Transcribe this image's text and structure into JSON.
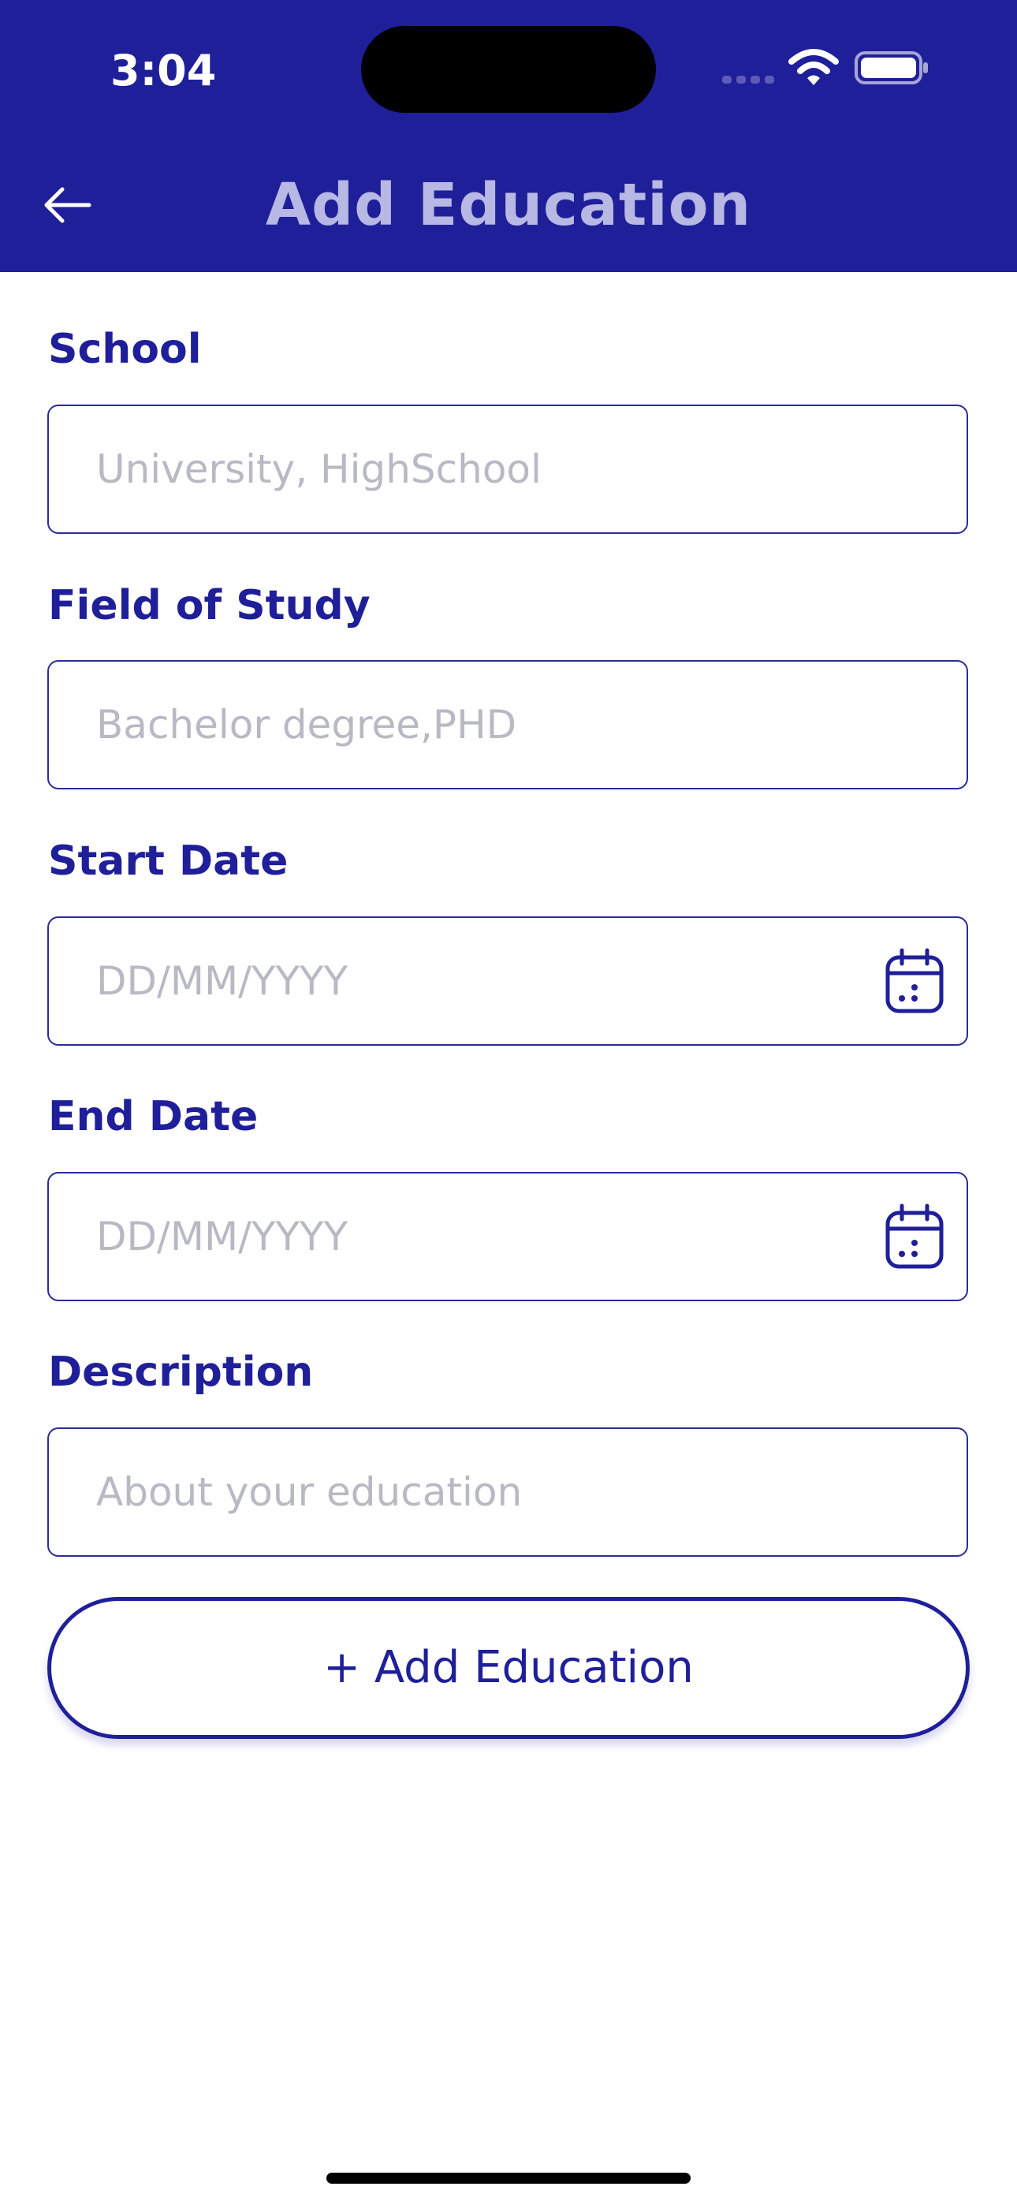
{
  "status_bar": {
    "time": "3:04"
  },
  "header": {
    "title": "Add Education",
    "back_icon": "arrow-left-icon",
    "background_color": "#1f1f9a",
    "title_color": "#b7b8e3"
  },
  "form": {
    "school": {
      "label": "School",
      "placeholder": "University, HighSchool"
    },
    "field_of_study": {
      "label": "Field of Study",
      "placeholder": "Bachelor degree,PHD"
    },
    "start_date": {
      "label": "Start Date",
      "placeholder": "DD/MM/YYYY",
      "icon": "calendar-icon"
    },
    "end_date": {
      "label": "End Date",
      "placeholder": "DD/MM/YYYY",
      "icon": "calendar-icon"
    },
    "description": {
      "label": "Description",
      "placeholder": "About your education"
    }
  },
  "actions": {
    "add_button_label": "+ Add Education"
  },
  "colors": {
    "accent": "#1f1f9a",
    "placeholder": "#b9b9c3"
  }
}
